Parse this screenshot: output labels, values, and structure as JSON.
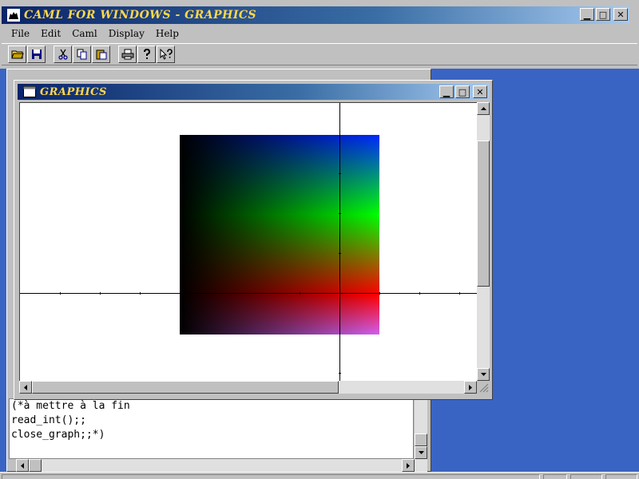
{
  "app": {
    "title": "CAML FOR WINDOWS - GRAPHICS",
    "menu": [
      "File",
      "Edit",
      "Caml",
      "Display",
      "Help"
    ],
    "toolbar_icons": [
      "open-icon",
      "save-icon",
      "cut-icon",
      "copy-icon",
      "paste-icon",
      "print-icon",
      "help-icon",
      "context-help-icon"
    ]
  },
  "graphics_window": {
    "title": "GRAPHICS",
    "gradient_colors": [
      "#0028ff",
      "#00ff00",
      "#ff0000",
      "#d060f0"
    ]
  },
  "toplevel": {
    "lines": [
      "(*à mettre à la fin",
      "read_int();;",
      "close_graph;;*)"
    ]
  },
  "colors": {
    "title_text": "#ffd84a",
    "title_start": "#0a246a",
    "desktop": "#3a64c4"
  }
}
